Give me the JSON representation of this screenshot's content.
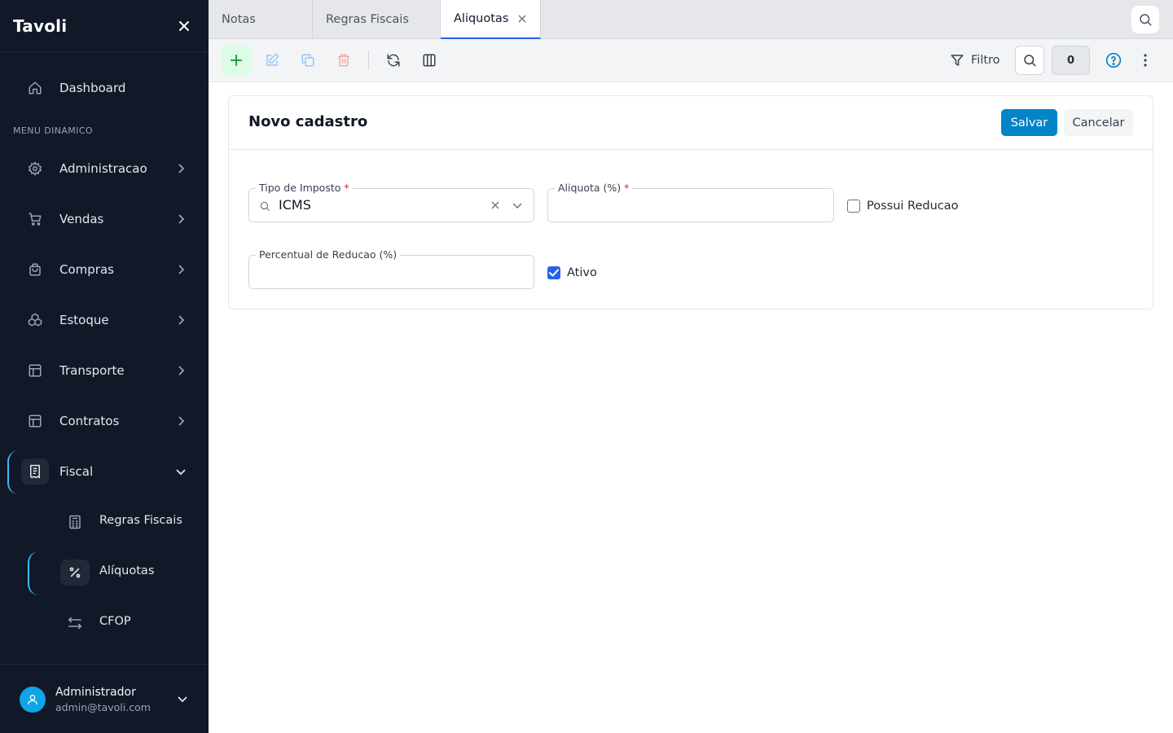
{
  "app": {
    "name": "Tavoli"
  },
  "sidebar": {
    "dashboard_label": "Dashboard",
    "section_title": "MENU DINAMICO",
    "items": [
      {
        "label": "Administracao"
      },
      {
        "label": "Vendas"
      },
      {
        "label": "Compras"
      },
      {
        "label": "Estoque"
      },
      {
        "label": "Transporte"
      },
      {
        "label": "Contratos"
      },
      {
        "label": "Fiscal"
      }
    ],
    "subitems": [
      {
        "label": "Regras Fiscais"
      },
      {
        "label": "Alíquotas"
      },
      {
        "label": "CFOP"
      }
    ],
    "user": {
      "name": "Administrador",
      "email": "admin@tavoli.com"
    }
  },
  "tabs": [
    {
      "label": "Notas"
    },
    {
      "label": "Regras Fiscais"
    },
    {
      "label": "Aliquotas"
    }
  ],
  "toolbar": {
    "filter_label": "Filtro",
    "count": "0"
  },
  "form": {
    "title": "Novo cadastro",
    "save_label": "Salvar",
    "cancel_label": "Cancelar",
    "tipo_imposto": {
      "label": "Tipo de Imposto",
      "value": "ICMS",
      "required": "*"
    },
    "aliquota": {
      "label": "Aliquota (%)",
      "value": "",
      "required": "*"
    },
    "possui_reducao": {
      "label": "Possui Reducao",
      "checked": false
    },
    "percentual_reducao": {
      "label": "Percentual de Reducao (%)",
      "value": ""
    },
    "ativo": {
      "label": "Ativo",
      "checked": true
    }
  },
  "colors": {
    "sidebar_bg": "#111827",
    "accent": "#0284c7",
    "active_indicator": "#38bdf8",
    "add_green": "#16a34a",
    "delete_red": "#ef4444"
  }
}
